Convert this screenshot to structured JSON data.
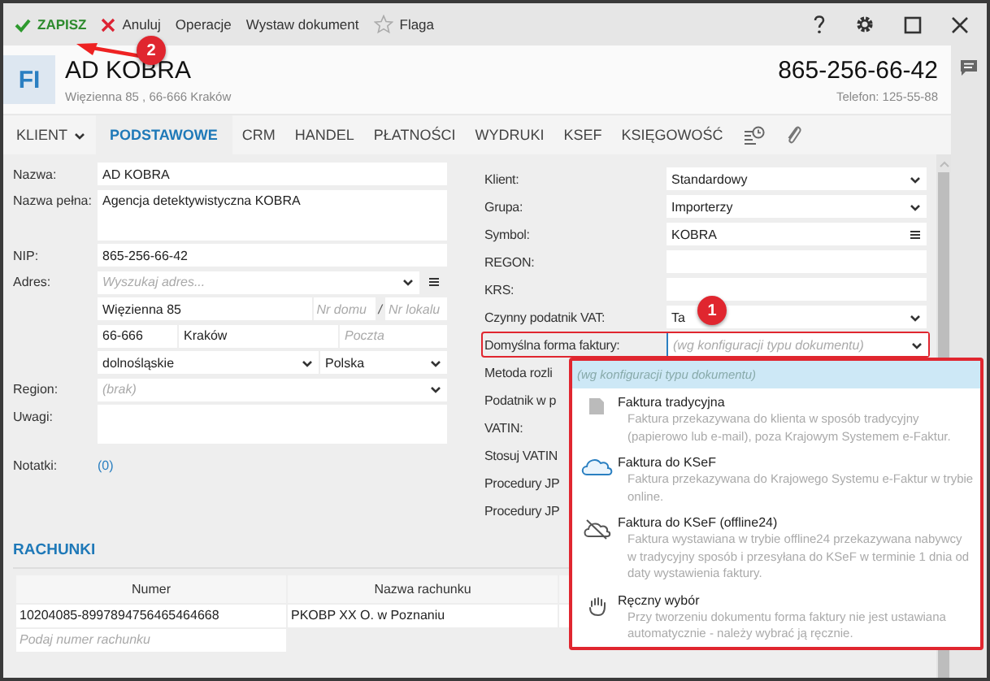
{
  "toolbar": {
    "actions": [
      {
        "kind": "save",
        "label": "ZAPISZ"
      },
      {
        "kind": "cancel",
        "label": "Anuluj"
      },
      {
        "kind": "plain",
        "label": "Operacje"
      },
      {
        "kind": "plain",
        "label": "Wystaw dokument"
      },
      {
        "kind": "flag",
        "label": "Flaga"
      }
    ]
  },
  "header": {
    "badge": "FI",
    "name": "AD KOBRA",
    "address": "Więzienna  85 , 66-666 Kraków",
    "phone": "865-256-66-42",
    "phone_note": "Telefon: 125-55-88"
  },
  "tabs": [
    {
      "kind": "menu",
      "label": "KLIENT",
      "selected": false
    },
    {
      "kind": "text",
      "label": "PODSTAWOWE",
      "selected": true
    },
    {
      "kind": "text",
      "label": "CRM",
      "selected": false
    },
    {
      "kind": "text",
      "label": "HANDEL",
      "selected": false
    },
    {
      "kind": "text",
      "label": "PŁATNOŚCI",
      "selected": false
    },
    {
      "kind": "text",
      "label": "WYDRUKI",
      "selected": false
    },
    {
      "kind": "text",
      "label": "KSEF",
      "selected": false
    },
    {
      "kind": "text",
      "label": "KSIĘGOWOŚĆ",
      "selected": false
    },
    {
      "kind": "history",
      "selected": false
    },
    {
      "kind": "attachment",
      "selected": false
    }
  ],
  "left_fields": [
    {
      "kind": "text",
      "label": "Nazwa:",
      "value": "AD KOBRA"
    },
    {
      "kind": "textarea",
      "label": "Nazwa pełna:",
      "value": "Agencja detektywistyczna KOBRA"
    },
    {
      "kind": "text",
      "label": "NIP:",
      "value": "865-256-66-42"
    },
    {
      "kind": "search",
      "label": "Adres:",
      "placeholder": "Wyszukaj adres..."
    },
    {
      "kind": "street",
      "value": "Więzienna  85",
      "house_placeholder": "Nr domu",
      "separator": "/",
      "flat_placeholder": "Nr lokalu"
    },
    {
      "kind": "city",
      "postcode": "66-666",
      "city": "Kraków",
      "post_placeholder": "Poczta"
    },
    {
      "kind": "province",
      "province": "dolnośląskie",
      "country": "Polska"
    },
    {
      "kind": "select",
      "label": "Region:",
      "placeholder": "(brak)"
    },
    {
      "kind": "notes",
      "label": "Uwagi:"
    },
    {
      "kind": "link",
      "label": "Notatki:",
      "value": "(0)"
    }
  ],
  "right_fields": [
    {
      "kind": "select",
      "label": "Klient:",
      "value": "Standardowy",
      "outlined": false
    },
    {
      "kind": "select",
      "label": "Grupa:",
      "value": "Importerzy",
      "outlined": false
    },
    {
      "kind": "menu",
      "label": "Symbol:",
      "value": "KOBRA",
      "outlined": false
    },
    {
      "kind": "text",
      "label": "REGON:",
      "outlined": false
    },
    {
      "kind": "text",
      "label": "KRS:",
      "outlined": false
    },
    {
      "kind": "select",
      "label": "Czynny podatnik VAT:",
      "value": "Ta",
      "outlined": false
    },
    {
      "kind": "select",
      "label": "Domyślna forma faktury:",
      "placeholder": "(wg konfiguracji typu dokumentu)",
      "outlined": true
    },
    {
      "kind": "label",
      "label": "Metoda rozli",
      "outlined": false
    },
    {
      "kind": "label",
      "label": "Podatnik w p",
      "outlined": false
    },
    {
      "kind": "label",
      "label": "VATIN:",
      "outlined": false
    },
    {
      "kind": "label",
      "label": "Stosuj VATIN",
      "outlined": false
    },
    {
      "kind": "label",
      "label": "Procedury JP",
      "outlined": false
    },
    {
      "kind": "label",
      "label": "Procedury JP",
      "outlined": false
    }
  ],
  "dropdown": {
    "outlined": true,
    "options": [
      {
        "kind": "default",
        "title": "(wg konfiguracji typu dokumentu)",
        "selected": true
      },
      {
        "kind": "paper",
        "title": "Faktura tradycyjna",
        "description": "Faktura przekazywana do klienta w sposób tradycyjny (papierowo lub e-mail), poza Krajowym Systemem e-Faktur.",
        "selected": false
      },
      {
        "kind": "cloud",
        "title": "Faktura do KSeF",
        "description": "Faktura przekazywana do Krajowego Systemu e-Faktur w trybie online.",
        "selected": false
      },
      {
        "kind": "offline",
        "title": "Faktura do KSeF (offline24)",
        "description": "Faktura wystawiana w trybie offline24 przekazywana nabywcy w tradycyjny sposób i przesyłana do KSeF w terminie 1 dnia od daty wystawienia faktury.",
        "selected": false
      },
      {
        "kind": "hand",
        "title": "Ręczny wybór",
        "description": "Przy tworzeniu dokumentu forma faktury nie jest ustawiana automatycznie - należy wybrać ją ręcznie.",
        "selected": false
      }
    ]
  },
  "accounts": {
    "title": "RACHUNKI",
    "columns": [
      "Numer",
      "Nazwa rachunku"
    ],
    "rows": [
      [
        "10204085-8997894756465464668",
        "PKOBP XX O. w Poznaniu"
      ]
    ],
    "placeholder": "Podaj numer rachunku"
  },
  "annotations": [
    {
      "kind": "badge",
      "label": "1"
    },
    {
      "kind": "badge",
      "label": "2"
    },
    {
      "kind": "arrow"
    }
  ]
}
